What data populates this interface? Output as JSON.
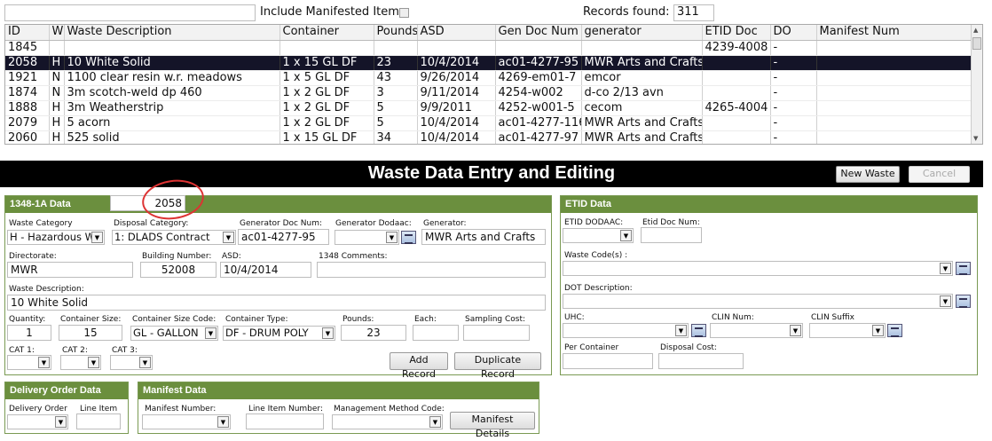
{
  "top": {
    "search_value": "",
    "include_label": "Include Manifested Items",
    "records_label": "Records found:",
    "records_value": "311"
  },
  "grid": {
    "columns": [
      "ID",
      "W",
      "Waste Description",
      "Container",
      "Pounds",
      "ASD",
      "Gen Doc Num",
      "generator",
      "ETID Doc",
      "DO",
      "Manifest Num"
    ],
    "rows": [
      [
        "1845",
        "",
        "",
        "",
        "",
        "",
        "",
        "",
        "4239-4008",
        "-",
        ""
      ],
      [
        "2058",
        "H",
        "10 White Solid",
        "1 x 15 GL DF",
        "23",
        "10/4/2014",
        "ac01-4277-95",
        "MWR Arts and Crafts",
        "",
        "-",
        ""
      ],
      [
        "1921",
        "N",
        "1100 clear resin w.r. meadows",
        "1 x 5 GL DF",
        "43",
        "9/26/2014",
        "4269-em01-7",
        "emcor",
        "",
        "-",
        ""
      ],
      [
        "1874",
        "N",
        "3m scotch-weld dp 460",
        "1 x 2 GL DF",
        "3",
        "9/11/2014",
        "4254-w002",
        "d-co 2/13 avn",
        "",
        "-",
        ""
      ],
      [
        "1888",
        "H",
        "3m Weatherstrip",
        "1 x 2 GL DF",
        "5",
        "9/9/2011",
        "4252-w001-5",
        "cecom",
        "4265-4004",
        "-",
        ""
      ],
      [
        "2079",
        "H",
        "5 acorn",
        "1 x 2 GL DF",
        "5",
        "10/4/2014",
        "ac01-4277-116",
        "MWR Arts and Crafts",
        "",
        "-",
        ""
      ],
      [
        "2060",
        "H",
        "525 solid",
        "1 x 15 GL DF",
        "34",
        "10/4/2014",
        "ac01-4277-97",
        "MWR Arts and Crafts",
        "",
        "-",
        ""
      ]
    ],
    "selected_row": 1
  },
  "header": {
    "title": "Waste Data Entry and Editing",
    "new_label": "New Waste",
    "cancel_label": "Cancel"
  },
  "p1348": {
    "title": "1348-1A Data",
    "id_value": "2058",
    "waste_category_label": "Waste Category",
    "waste_category": "H - Hazardous W",
    "disposal_category_label": "Disposal Category:",
    "disposal_category": "1: DLADS Contract",
    "gen_doc_label": "Generator Doc Num:",
    "gen_doc": "ac01-4277-95",
    "gen_dodaac_label": "Generator Dodaac:",
    "gen_dodaac": "",
    "generator_label": "Generator:",
    "generator": "MWR Arts and Crafts",
    "directorate_label": "Directorate:",
    "directorate": "MWR",
    "building_label": "Building Number:",
    "building": "52008",
    "asd_label": "ASD:",
    "asd": "10/4/2014",
    "comments_label": "1348 Comments:",
    "comments": "",
    "desc_label": "Waste Description:",
    "desc": "10 White Solid",
    "qty_label": "Quantity:",
    "qty": "1",
    "csize_label": "Container Size:",
    "csize": "15",
    "csize_code_label": "Container Size Code:",
    "csize_code": "GL - GALLON",
    "ctype_label": "Container Type:",
    "ctype": "DF - DRUM POLY",
    "pounds_label": "Pounds:",
    "pounds": "23",
    "each_label": "Each:",
    "each": "",
    "sampling_label": "Sampling Cost:",
    "sampling": "",
    "cat1_label": "CAT 1:",
    "cat2_label": "CAT 2:",
    "cat3_label": "CAT 3:",
    "add_label": "Add Record",
    "dup_label": "Duplicate Record"
  },
  "etid": {
    "title": "ETID Data",
    "dodaac_label": "ETID DODAAC:",
    "docnum_label": "Etid Doc Num:",
    "waste_codes_label": "Waste Code(s) :",
    "dot_label": "DOT Description:",
    "uhc_label": "UHC:",
    "clin_label": "CLIN Num:",
    "clin_suffix_label": "CLIN Suffix",
    "per_container_label": "Per Container",
    "disposal_cost_label": "Disposal Cost:"
  },
  "delivery": {
    "title": "Delivery Order Data",
    "do_label": "Delivery Order",
    "line_label": "Line Item"
  },
  "manifest": {
    "title": "Manifest Data",
    "num_label": "Manifest Number:",
    "line_label": "Line Item Number:",
    "mgmt_label": "Management Method Code:",
    "details_label": "Manifest Details"
  }
}
